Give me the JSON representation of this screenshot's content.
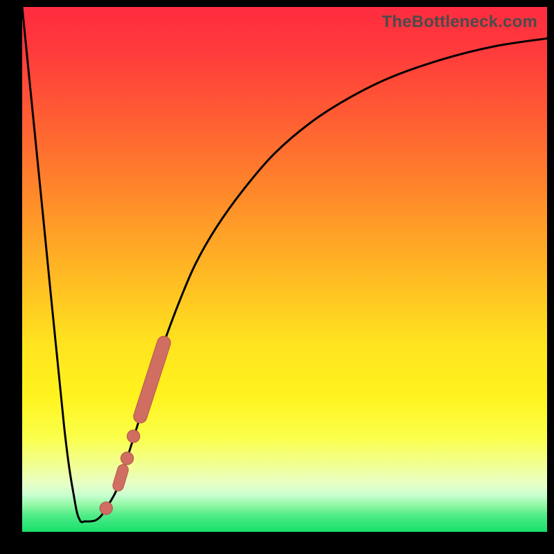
{
  "watermark": "TheBottleneck.com",
  "colors": {
    "frame": "#000000",
    "curve": "#000000",
    "marker_fill": "#cf6e61",
    "marker_stroke": "#b85a50",
    "gradient_top": "#ff2c3f",
    "gradient_bottom": "#18e06a"
  },
  "chart_data": {
    "type": "line",
    "title": "",
    "xlabel": "",
    "ylabel": "",
    "xlim": [
      0,
      100
    ],
    "ylim": [
      0,
      100
    ],
    "grid": false,
    "series": [
      {
        "name": "curve",
        "x": [
          0,
          4,
          8,
          10,
          11,
          12,
          13,
          14,
          15,
          16,
          18,
          20,
          22.5,
          25,
          27,
          30,
          33,
          37,
          42,
          48,
          55,
          62,
          70,
          80,
          90,
          100
        ],
        "values": [
          100,
          60,
          20,
          6,
          2.2,
          2.0,
          2.0,
          2.2,
          3.0,
          4.5,
          8,
          14,
          22,
          30,
          36,
          44,
          51,
          58,
          65,
          72,
          78,
          82.5,
          86.5,
          90,
          92.5,
          94
        ]
      }
    ],
    "markers": [
      {
        "shape": "pill",
        "x0": 22.5,
        "y0": 22,
        "x1": 27.0,
        "y1": 36,
        "width": 2.4
      },
      {
        "shape": "circle",
        "x": 21.2,
        "y": 18.2,
        "r": 1.2
      },
      {
        "shape": "circle",
        "x": 20.0,
        "y": 14.0,
        "r": 1.2
      },
      {
        "shape": "pill",
        "x0": 18.3,
        "y0": 8.8,
        "x1": 19.2,
        "y1": 11.8,
        "width": 1.9
      },
      {
        "shape": "circle",
        "x": 16.0,
        "y": 4.5,
        "r": 1.2
      }
    ]
  }
}
